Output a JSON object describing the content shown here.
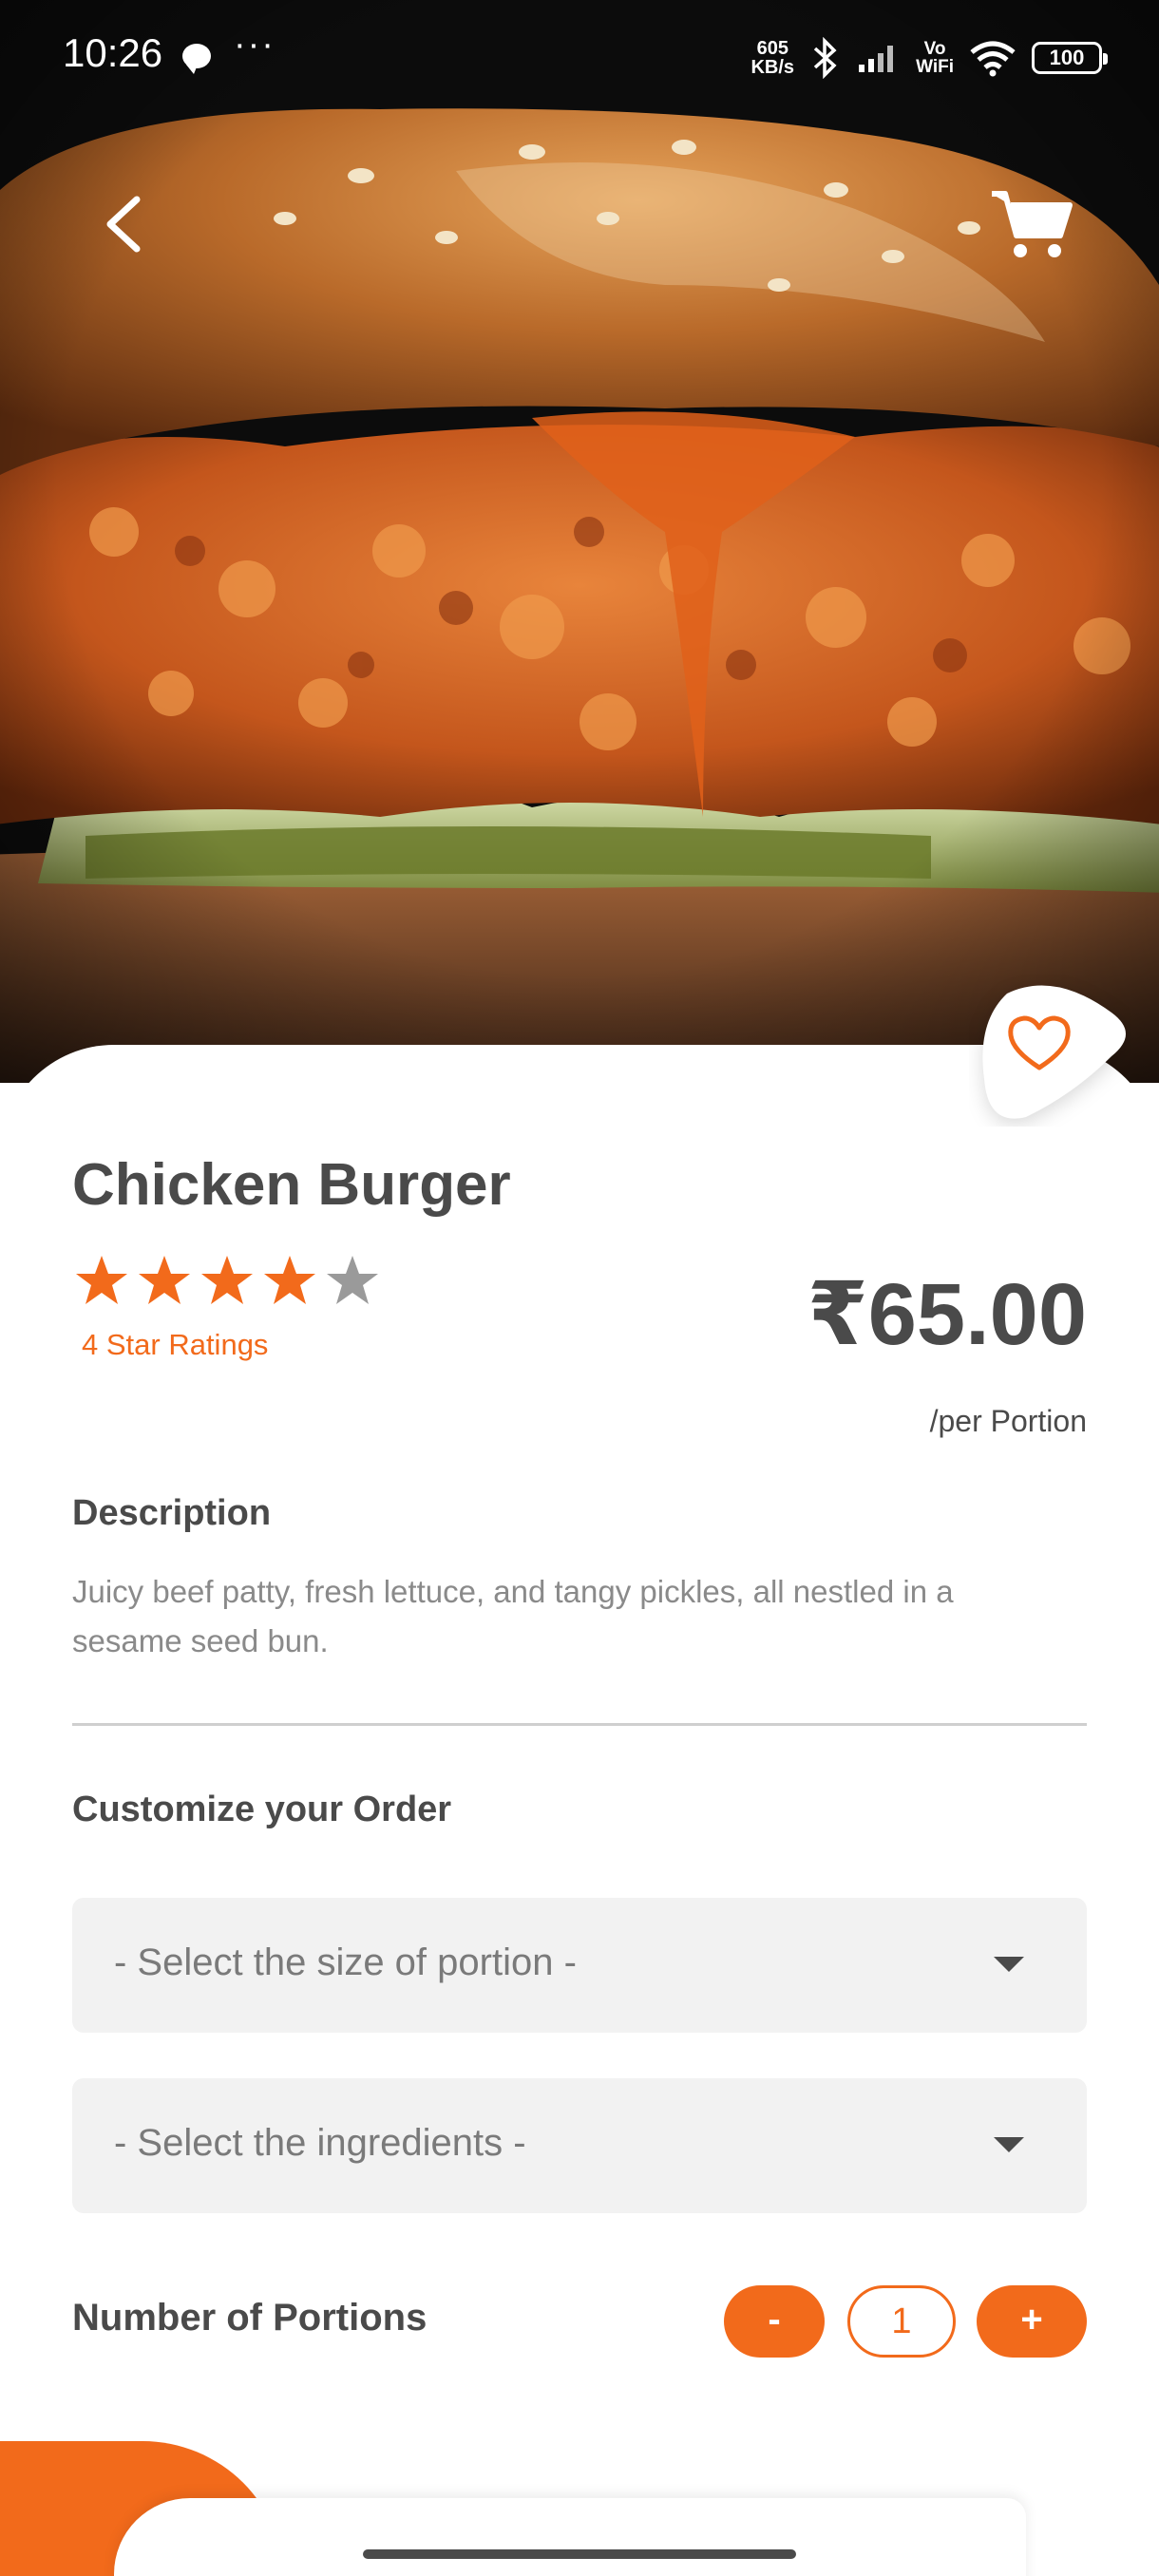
{
  "status_bar": {
    "time": "10:26",
    "net_speed_top": "605",
    "net_speed_bottom": "KB/s",
    "vowifi_top": "Vo",
    "vowifi_bottom": "WiFi",
    "battery": "100",
    "icons": [
      "message-icon",
      "more-dots-icon",
      "bluetooth-icon",
      "signal-icon",
      "wifi-icon",
      "battery-icon"
    ]
  },
  "header": {
    "back_icon": "chevron-left-icon",
    "cart_icon": "cart-icon"
  },
  "product": {
    "name": "Chicken Burger",
    "rating": 4,
    "rating_max": 5,
    "rating_text": "4 Star Ratings",
    "price": "₹65.00",
    "price_unit": "/per Portion",
    "favorite_icon": "heart-icon"
  },
  "description": {
    "title": "Description",
    "text": "Juicy beef patty, fresh lettuce, and tangy pickles, all nestled in a sesame seed bun."
  },
  "customize": {
    "title": "Customize your Order",
    "size_select": "- Select the size of portion -",
    "ingredients_select": "- Select the ingredients -"
  },
  "portions": {
    "label": "Number of Portions",
    "minus": "-",
    "value": "1",
    "plus": "+"
  },
  "colors": {
    "accent": "#f26a1b",
    "text": "#4a4a4a",
    "muted": "#8a8a8a",
    "field_bg": "#f2f2f2"
  }
}
